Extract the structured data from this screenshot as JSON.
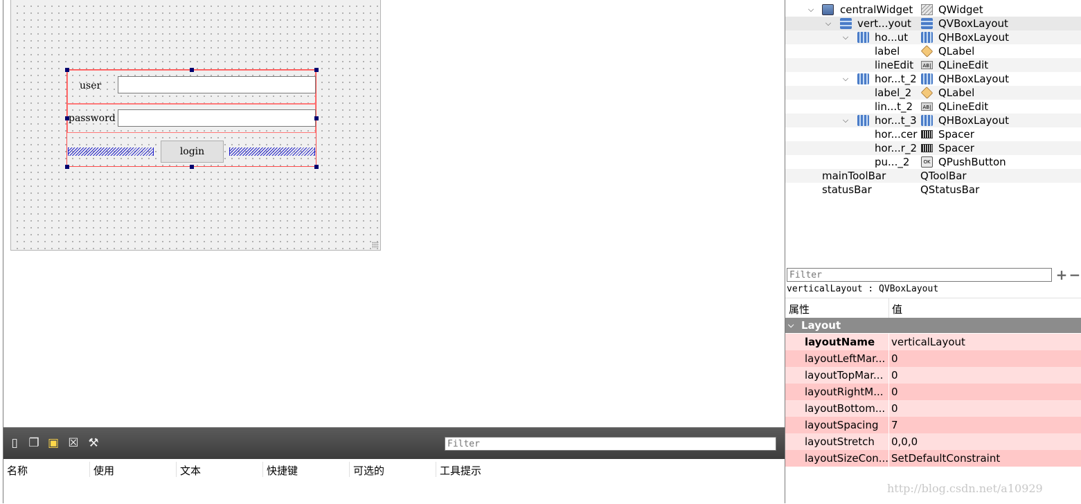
{
  "form": {
    "user_label": "user",
    "password_label": "password",
    "login_button": "login"
  },
  "action_editor": {
    "filter_placeholder": "Filter",
    "toolbar_icons": [
      "new-action-icon",
      "copy-action-icon",
      "paste-action-icon",
      "delete-action-icon",
      "configure-icon"
    ],
    "columns": [
      "名称",
      "使用",
      "文本",
      "快捷键",
      "可选的",
      "工具提示"
    ]
  },
  "object_inspector": {
    "rows": [
      {
        "name": "centralWidget",
        "class": "QWidget",
        "icon": "widget-icon",
        "class_icon": "qwidget-icon"
      },
      {
        "name": "vert...yout",
        "class": "QVBoxLayout",
        "icon": "vbox-layout-icon",
        "class_icon": "vbox-layout-icon"
      },
      {
        "name": "ho...ut",
        "class": "QHBoxLayout",
        "icon": "hbox-layout-icon",
        "class_icon": "hbox-layout-icon"
      },
      {
        "name": "label",
        "class": "QLabel",
        "icon": "",
        "class_icon": "label-icon"
      },
      {
        "name": "lineEdit",
        "class": "QLineEdit",
        "icon": "",
        "class_icon": "lineedit-icon"
      },
      {
        "name": "hor...t_2",
        "class": "QHBoxLayout",
        "icon": "hbox-layout-icon",
        "class_icon": "hbox-layout-icon"
      },
      {
        "name": "label_2",
        "class": "QLabel",
        "icon": "",
        "class_icon": "label-icon"
      },
      {
        "name": "lin...t_2",
        "class": "QLineEdit",
        "icon": "",
        "class_icon": "lineedit-icon"
      },
      {
        "name": "hor...t_3",
        "class": "QHBoxLayout",
        "icon": "hbox-layout-icon",
        "class_icon": "hbox-layout-icon"
      },
      {
        "name": "hor...cer",
        "class": "Spacer",
        "icon": "",
        "class_icon": "spacer-icon"
      },
      {
        "name": "hor...r_2",
        "class": "Spacer",
        "icon": "",
        "class_icon": "spacer-icon"
      },
      {
        "name": "pu..._2",
        "class": "QPushButton",
        "icon": "",
        "class_icon": "pushbutton-icon"
      },
      {
        "name": "mainToolBar",
        "class": "QToolBar",
        "icon": "",
        "class_icon": ""
      },
      {
        "name": "statusBar",
        "class": "QStatusBar",
        "icon": "",
        "class_icon": ""
      }
    ]
  },
  "property_editor": {
    "filter_placeholder": "Filter",
    "selected_object": "verticalLayout : QVBoxLayout",
    "header_property": "属性",
    "header_value": "值",
    "group": "Layout",
    "properties": [
      {
        "name": "layoutName",
        "value": "verticalLayout",
        "bold": true
      },
      {
        "name": "layoutLeftMar...",
        "value": "0"
      },
      {
        "name": "layoutTopMar...",
        "value": "0"
      },
      {
        "name": "layoutRightM...",
        "value": "0"
      },
      {
        "name": "layoutBottom...",
        "value": "0"
      },
      {
        "name": "layoutSpacing",
        "value": "7"
      },
      {
        "name": "layoutStretch",
        "value": "0,0,0"
      },
      {
        "name": "layoutSizeCon...",
        "value": "SetDefaultConstraint"
      }
    ]
  },
  "watermark": "http://blog.csdn.net/a10929",
  "colors": {
    "layout_outline": "#ff4c4c",
    "selection_handle": "#00006e",
    "spacer": "#1e1ec8",
    "property_row_light": "#ffdede",
    "property_row_dark": "#ffc8c8",
    "group_header": "#8c8c8c"
  }
}
